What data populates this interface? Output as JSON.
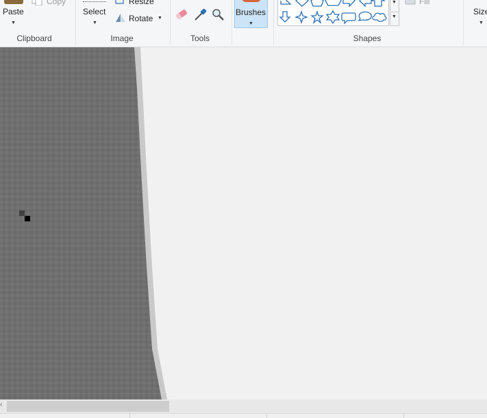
{
  "ribbon": {
    "clipboard": {
      "paste_label": "Paste",
      "copy_label": "Copy",
      "group_label": "Clipboard"
    },
    "image": {
      "select_label": "Select",
      "resize_label": "Resize",
      "rotate_label": "Rotate",
      "group_label": "Image"
    },
    "tools": {
      "group_label": "Tools",
      "icons": [
        "eraser-icon",
        "color-picker-icon",
        "magnifier-icon"
      ]
    },
    "brushes": {
      "label": "Brushes",
      "selected": true
    },
    "shapes": {
      "group_label": "Shapes",
      "fill_label": "Fill",
      "gallery": [
        "right-triangle",
        "diamond",
        "pentagon",
        "hexagon",
        "right-arrow",
        "left-arrow",
        "up-arrow",
        "down-arrow",
        "four-point-star",
        "five-point-star",
        "six-point-star",
        "rounded-rect-callout",
        "oval-callout",
        "cloud-callout"
      ]
    },
    "size": {
      "label": "Size"
    }
  },
  "colors": {
    "accent": "#cce4f7",
    "accent_border": "#99c9ef",
    "shape_stroke": "#2a6fb5",
    "canvas_bg": "#f1f1f1"
  }
}
